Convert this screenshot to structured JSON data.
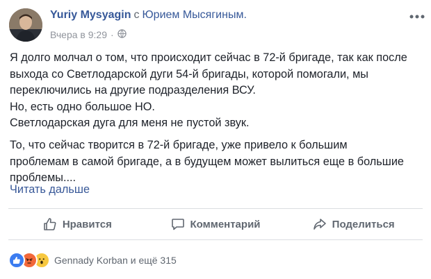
{
  "header": {
    "author_name": "Yuriy Mysyagin",
    "with_word": "с",
    "tagged_name": "Юрием Мысягиным.",
    "timestamp": "Вчера в 9:29",
    "audience_icon": "globe-icon",
    "more_icon": "ellipsis-icon"
  },
  "body": {
    "paragraph1": [
      "Я долго молчал о том, что происходит сейчас в 72-й бригаде, так как после",
      "выхода со Светлодарской дуги 54-й бригады, которой помогали, мы",
      "переключились на другие подразделения ВСУ.",
      "Но, есть одно большое НО.",
      "Светлодарская дуга для меня не пустой звук."
    ],
    "paragraph2": [
      "То, что сейчас творится в 72-й бригаде, уже привело к большим",
      "проблемам в самой бригаде, а в будущем может вылиться еще в большие",
      "проблемы...."
    ],
    "read_more": "Читать дальше"
  },
  "actions": {
    "like": "Нравится",
    "comment": "Комментарий",
    "share": "Поделиться"
  },
  "reactions": {
    "icons": [
      "like-icon",
      "angry-icon",
      "wow-icon"
    ],
    "summary": "Gennady Korban и ещё 315"
  },
  "colors": {
    "link": "#365899",
    "muted": "#606770",
    "like": "#3b7cf0",
    "angry": "#f2683a",
    "wow": "#f7c840"
  }
}
